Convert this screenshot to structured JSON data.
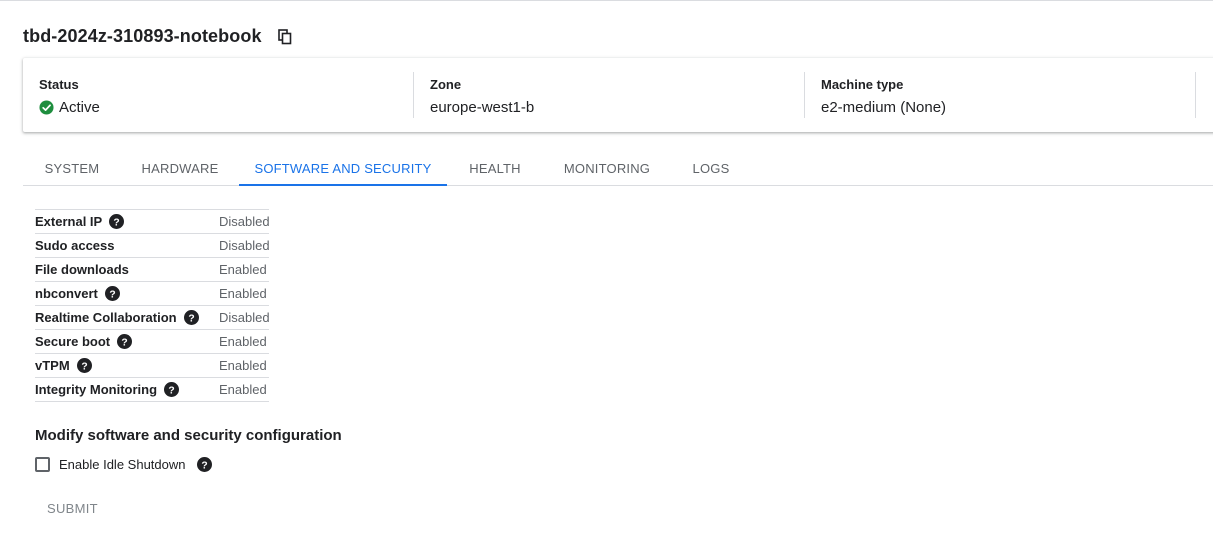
{
  "header": {
    "title": "tbd-2024z-310893-notebook",
    "copy_icon": "copy-icon"
  },
  "summary": {
    "status": {
      "label": "Status",
      "value": "Active",
      "icon": "check-circle-icon",
      "color": "#1e8e3e"
    },
    "zone": {
      "label": "Zone",
      "value": "europe-west1-b"
    },
    "machine_type": {
      "label": "Machine type",
      "value": "e2-medium (None)"
    }
  },
  "tabs": [
    {
      "label": "SYSTEM",
      "active": false
    },
    {
      "label": "HARDWARE",
      "active": false
    },
    {
      "label": "SOFTWARE AND SECURITY",
      "active": true
    },
    {
      "label": "HEALTH",
      "active": false
    },
    {
      "label": "MONITORING",
      "active": false
    },
    {
      "label": "LOGS",
      "active": false
    }
  ],
  "properties": [
    {
      "key": "External IP",
      "value": "Disabled",
      "help": true
    },
    {
      "key": "Sudo access",
      "value": "Disabled",
      "help": false
    },
    {
      "key": "File downloads",
      "value": "Enabled",
      "help": false
    },
    {
      "key": "nbconvert",
      "value": "Enabled",
      "help": true
    },
    {
      "key": "Realtime Collaboration",
      "value": "Disabled",
      "help": true
    },
    {
      "key": "Secure boot",
      "value": "Enabled",
      "help": true
    },
    {
      "key": "vTPM",
      "value": "Enabled",
      "help": true
    },
    {
      "key": "Integrity Monitoring",
      "value": "Enabled",
      "help": true
    }
  ],
  "modify": {
    "title": "Modify software and security configuration",
    "idle_shutdown_label": "Enable Idle Shutdown",
    "idle_shutdown_checked": false,
    "submit_label": "SUBMIT"
  },
  "colors": {
    "accent": "#1a73e8",
    "active_status": "#1e8e3e",
    "text_secondary": "#5f6368"
  }
}
